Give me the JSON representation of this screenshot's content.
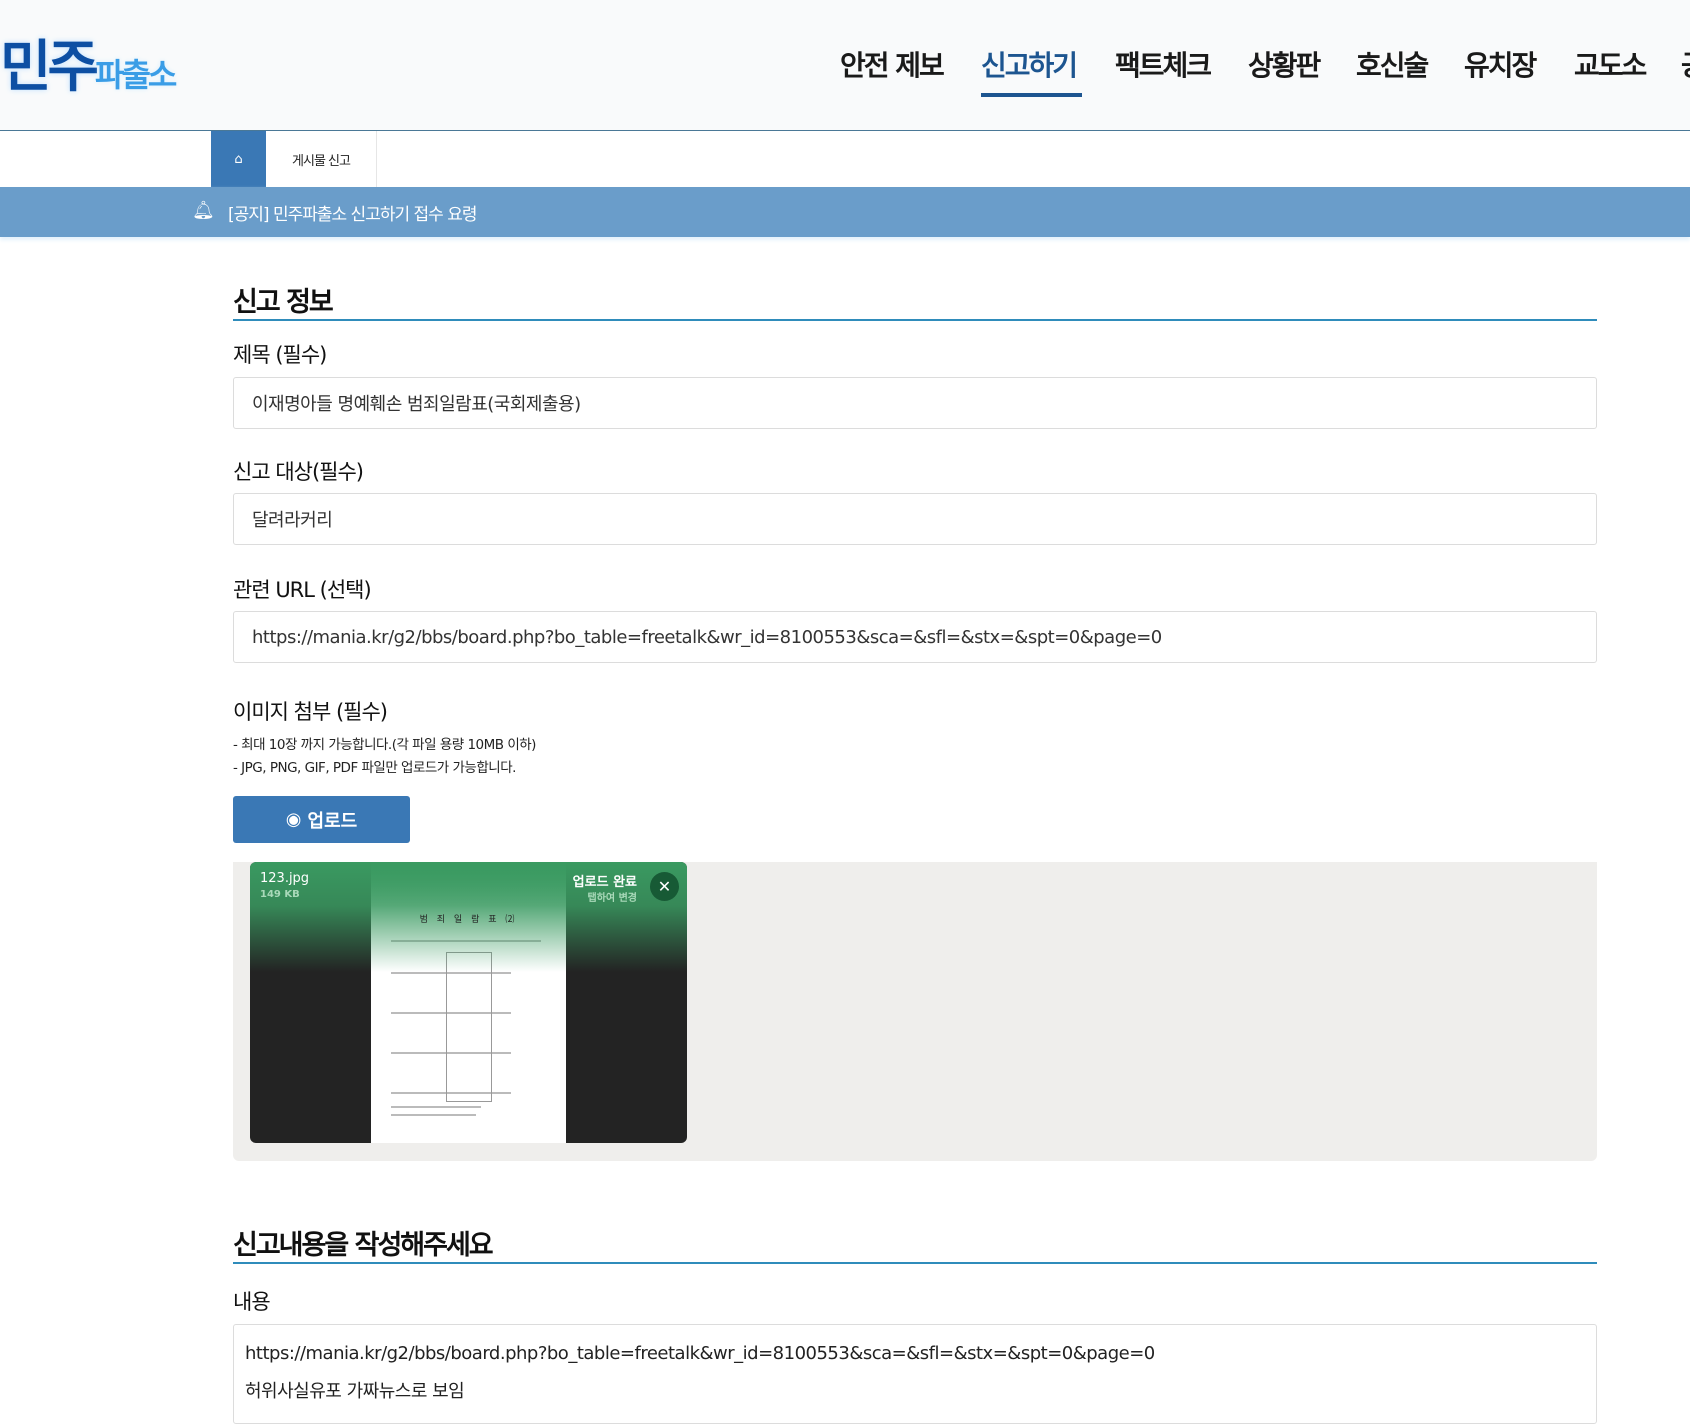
{
  "header": {
    "logo": {
      "main": "민주",
      "sub": "파출소"
    },
    "nav": [
      {
        "label": "안전 제보",
        "active": false
      },
      {
        "label": "신고하기",
        "active": true
      },
      {
        "label": "팩트체크",
        "active": false
      },
      {
        "label": "상황판",
        "active": false
      },
      {
        "label": "호신술",
        "active": false
      },
      {
        "label": "유치장",
        "active": false
      },
      {
        "label": "교도소",
        "active": false
      },
      {
        "label": "공",
        "active": false
      }
    ]
  },
  "breadcrumb": {
    "home_icon": "home-icon",
    "current": "게시물 신고"
  },
  "notice": {
    "icon": "bell-icon",
    "text": "[공지] 민주파출소 신고하기 접수 요령"
  },
  "form": {
    "section1_title": "신고 정보",
    "title_label": "제목 (필수)",
    "title_value": "이재명아들 명예훼손 범죄일람표(국회제출용)",
    "target_label": "신고 대상(필수)",
    "target_value": "달려라커리",
    "url_label": "관련 URL (선택)",
    "url_value": "https://mania.kr/g2/bbs/board.php?bo_table=freetalk&wr_id=8100553&sca=&sfl=&stx=&spt=0&page=0",
    "image_label": "이미지 첨부 (필수)",
    "image_notes": [
      "- 최대 10장 까지 가능합니다.(각 파일 용량 10MB 이하)",
      "- JPG, PNG, GIF, PDF 파일만 업로드가 가능합니다."
    ],
    "upload_button": "업로드",
    "attachments": [
      {
        "filename": "123.jpg",
        "size": "149 KB",
        "status": "업로드 완료",
        "hint": "탭하여 변경",
        "doc_title": "범 죄 일 람 표 ⑵"
      }
    ],
    "section2_title": "신고내용을 작성해주세요",
    "content_label": "내용",
    "content_lines": [
      "https://mania.kr/g2/bbs/board.php?bo_table=freetalk&wr_id=8100553&sca=&sfl=&stx=&spt=0&page=0",
      "허위사실유포 가짜뉴스로 보임"
    ]
  }
}
